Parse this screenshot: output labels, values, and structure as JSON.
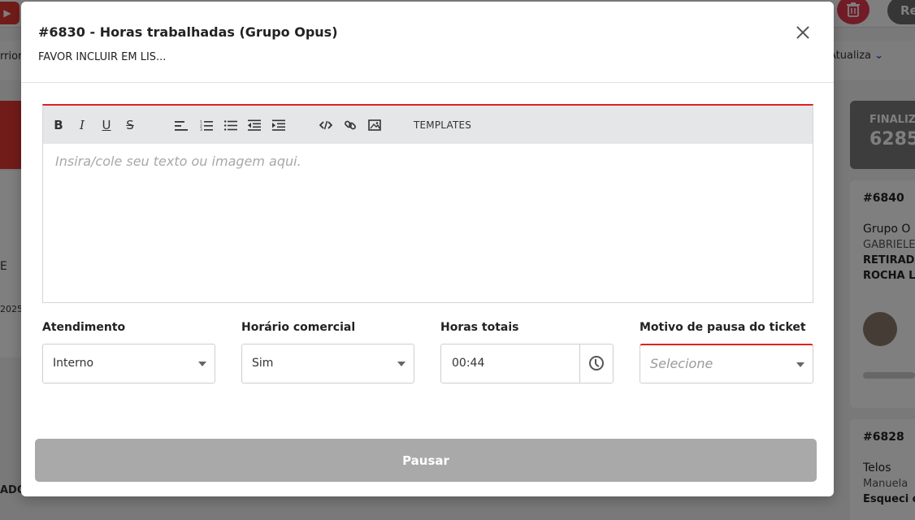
{
  "background": {
    "prioridade_fragment": "rriori",
    "atualiza_label": "Atualiza",
    "re_button": "Re",
    "left_fragment_e": "E",
    "left_fragment_year": "2025",
    "left_fragment_ado": "ADO",
    "final_label": "FINALIZ",
    "final_count": "6285",
    "cards": [
      {
        "id": "#6840",
        "line1": "Grupo O",
        "line2": "GABRIELE",
        "line3": "RETIRADA",
        "line4": "ROCHA L"
      },
      {
        "id": "#6828",
        "line1": "Telos",
        "line2": "Manuela",
        "line3": "Esqueci c"
      }
    ]
  },
  "modal": {
    "title": "#6830 - Horas trabalhadas (Grupo Opus)",
    "subtitle": "FAVOR INCLUIR EM LIS...",
    "close_icon": "close-icon",
    "editor": {
      "toolbar": {
        "bold": "B",
        "italic": "I",
        "underline": "U",
        "strike": "S",
        "templates": "TEMPLATES"
      },
      "placeholder": "Insira/cole seu texto ou imagem aqui."
    },
    "fields": {
      "atendimento": {
        "label": "Atendimento",
        "value": "Interno"
      },
      "horario_comercial": {
        "label": "Horário comercial",
        "value": "Sim"
      },
      "horas_totais": {
        "label": "Horas totais",
        "value": "00:44"
      },
      "motivo_pausa": {
        "label": "Motivo de pausa do ticket",
        "placeholder": "Selecione"
      }
    },
    "pause_button": "Pausar",
    "colors": {
      "accent_red": "#e02020",
      "button_gray": "#a9a9a9"
    }
  }
}
